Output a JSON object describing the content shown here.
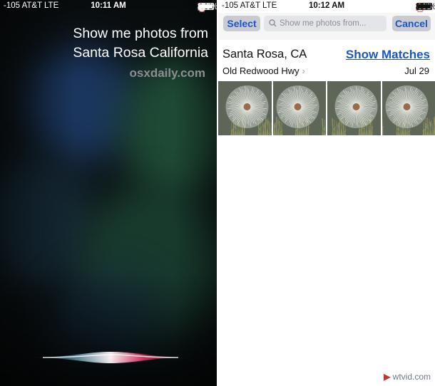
{
  "siri_screen": {
    "status_bar": {
      "carrier": "-105 AT&T",
      "network": "LTE",
      "time": "10:11 AM",
      "battery": "100%"
    },
    "query_line1": "Show me photos from",
    "query_line2": "Santa Rosa California",
    "watermark": "osxdaily.com"
  },
  "photos_screen": {
    "status_bar": {
      "carrier": "-105 AT&T",
      "network": "LTE",
      "time": "10:12 AM",
      "battery": "100%"
    },
    "select_label": "Select",
    "search_placeholder": "Show me photos from...",
    "cancel_label": "Cancel",
    "moment": {
      "place": "Santa Rosa, CA",
      "street": "Old Redwood Hwy",
      "show_matches": "Show Matches",
      "date": "Jul 29"
    },
    "thumbnails": [
      "dandelion-seed-head-photo",
      "dandelion-seed-head-photo",
      "dandelion-seed-head-photo",
      "dandelion-seed-head-photo"
    ]
  },
  "footer_logo": "wtvid.com",
  "colors": {
    "ios_blue": "#1a56c9",
    "siri_wave_pink": "#e83a6a",
    "siri_background": "#0c1214"
  }
}
